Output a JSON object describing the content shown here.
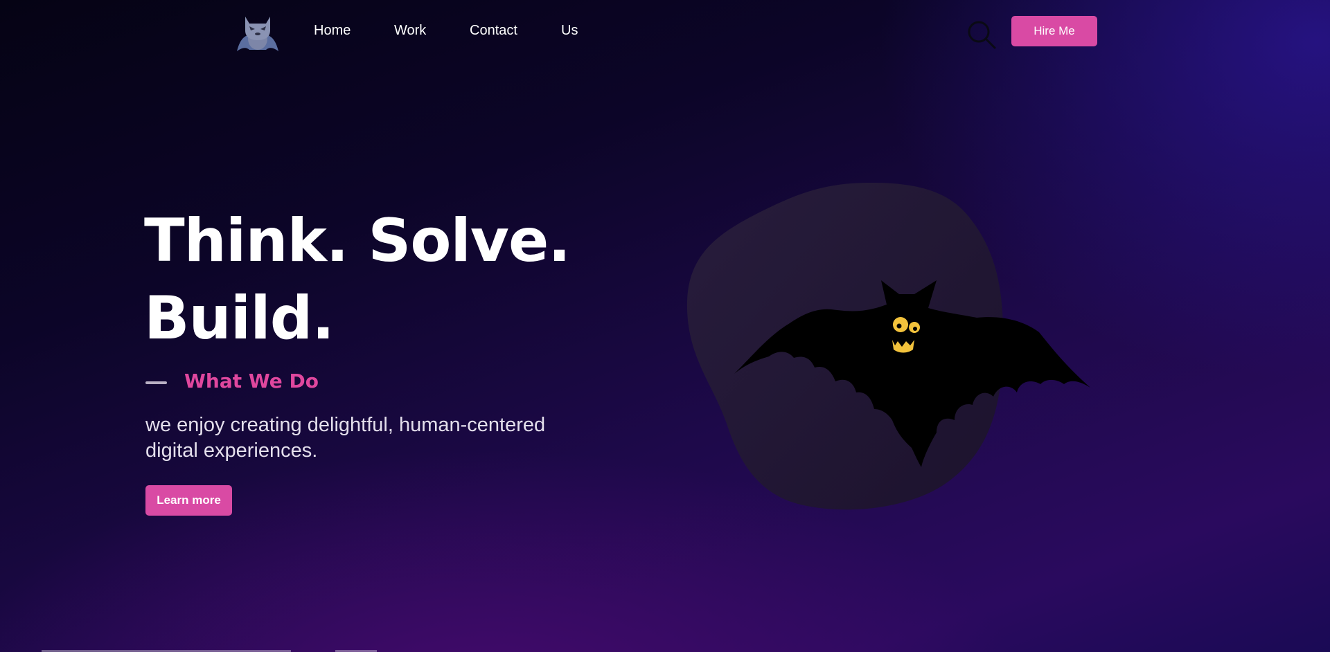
{
  "nav": {
    "logo_icon": "bat-mascot-icon",
    "links": [
      {
        "label": "Home"
      },
      {
        "label": "Work"
      },
      {
        "label": "Contact"
      },
      {
        "label": "Us"
      }
    ],
    "search_icon": "search-icon",
    "hire_label": "Hire Me"
  },
  "hero": {
    "headline_line1": "Think. Solve.",
    "headline_line2": "Build.",
    "subheading": "What We Do",
    "description": "we enjoy creating delightful, human-centered digital experiences.",
    "cta_label": "Learn more",
    "illustration_icon": "bat-illustration"
  },
  "colors": {
    "accent": "#d94aa4",
    "subheading": "#e0479e",
    "bat_eyes": "#f2c23c"
  }
}
